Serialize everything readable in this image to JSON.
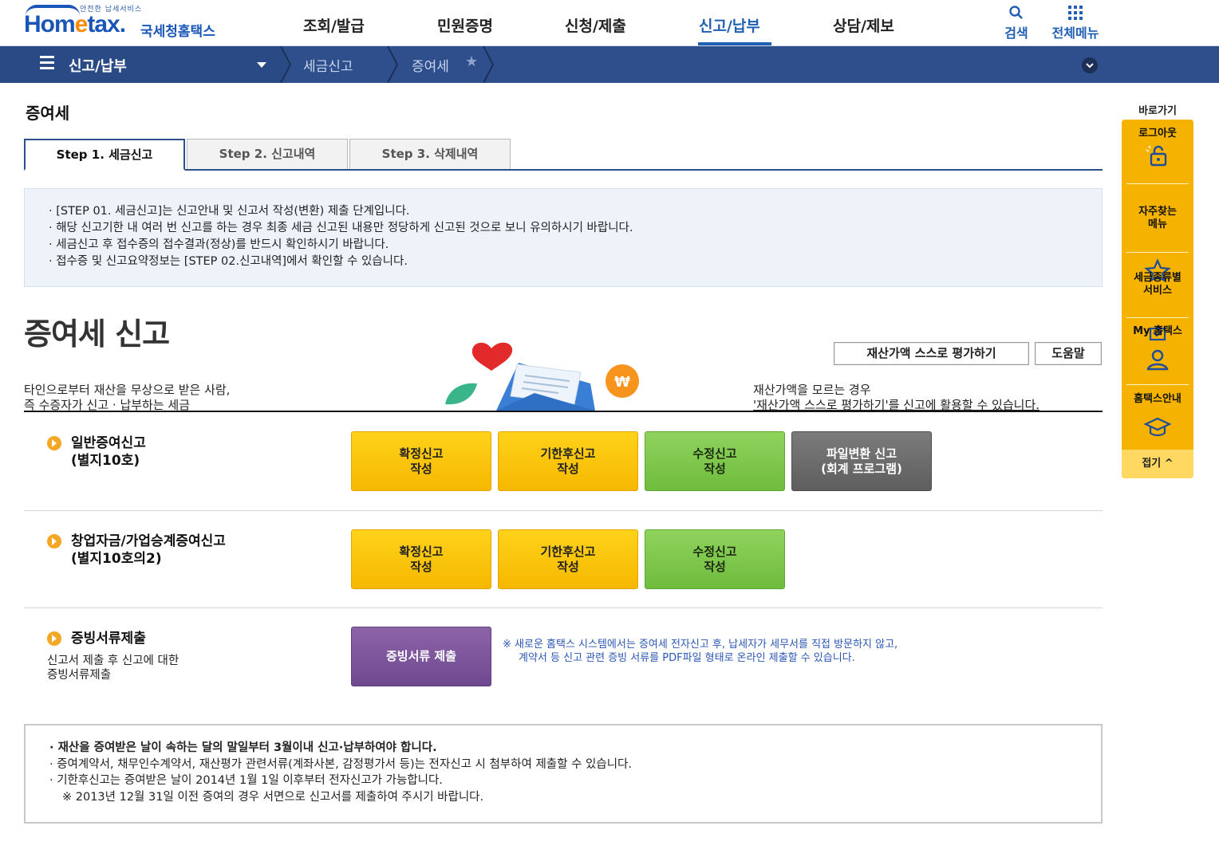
{
  "header": {
    "logo_tagline": "안전한 납세서비스",
    "logo_main_a": "Hom",
    "logo_main_e": "e",
    "logo_main_b": "tax.",
    "logo_sub": "국세청홈택스",
    "menu": [
      "조회/발급",
      "민원증명",
      "신청/제출",
      "신고/납부",
      "상담/제보"
    ],
    "active_menu_index": 3,
    "search_label": "검색",
    "all_menu_label": "전체메뉴"
  },
  "navbar": {
    "section": "신고/납부",
    "crumb1": "세금신고",
    "crumb2": "증여세",
    "star_icon": "star-icon",
    "collapse_icon": "chevron-down-icon"
  },
  "page": {
    "title": "증여세",
    "tabs": [
      "Step 1. 세금신고",
      "Step 2. 신고내역",
      "Step 3. 삭제내역"
    ],
    "active_tab": 0,
    "info_lines": [
      "[STEP 01. 세금신고]는 신고안내 및 신고서 작성(변환) 제출 단계입니다.",
      "해당 신고기한 내 여러 번 신고를 하는 경우 최종 세금 신고된 내용만 정당하게 신고된 것으로 보니 유의하시기 바랍니다.",
      "세금신고 후 접수증의 접수결과(정상)를 반드시 확인하시기 바랍니다.",
      "접수증 및 신고요약정보는 [STEP 02.신고내역]에서 확인할 수 있습니다."
    ],
    "big_title": "증여세 신고",
    "intro_left_1": "타인으로부터 재산을 무상으로 받은 사람,",
    "intro_left_2": "즉 수증자가 신고 · 납부하는 세금",
    "intro_right_1": "재산가액을 모르는 경우",
    "intro_right_2": "'재산가액 스스로 평가하기'를 신고에 활용할 수 있습니다.",
    "self_eval_button": "재산가액 스스로 평가하기",
    "help_button": "도움말"
  },
  "sections": {
    "general": {
      "label_1": "일반증여신고",
      "label_2": "(별지10호)",
      "btn_regular": "확정신고\n작성",
      "btn_late": "기한후신고\n작성",
      "btn_amend": "수정신고\n작성",
      "btn_file": "파일변환 신고\n(회계 프로그램)"
    },
    "startup": {
      "label_1": "창업자금/가업승계증여신고",
      "label_2": "(별지10호의2)",
      "btn_regular": "확정신고\n작성",
      "btn_late": "기한후신고\n작성",
      "btn_amend": "수정신고\n작성"
    },
    "docs": {
      "label": "증빙서류제출",
      "desc_1": "신고서 제출 후 신고에 대한",
      "desc_2": "증빙서류제출",
      "btn_submit": "증빙서류 제출",
      "notice_1": "※ 새로운 홈택스 시스템에서는 증여세 전자신고 후, 납세자가 세무서를 직접 방문하지 않고,",
      "notice_2": "계약서 등 신고 관련 증빙 서류를 PDF파일 형태로 온라인 제출할 수 있습니다."
    }
  },
  "bottom_notes": {
    "line1": "재산을 증여받은 날이 속하는 달의 말일부터 3월이내 신고·납부하여야 합니다.",
    "line2": "증여계약서, 채무인수계약서, 재산평가 관련서류(계좌사본, 감정평가서 등)는 전자신고 시 첨부하여 제출할 수 있습니다.",
    "line3": "기한후신고는 증여받은 날이 2014년 1월 1일 이후부터 전자신고가 가능합니다.",
    "line4": "※ 2013년 12월 31일 이전 증여의 경우 서면으로 신고서를 제출하여 주시기 바랍니다."
  },
  "quick_menu": {
    "title": "바로가기",
    "items": [
      {
        "label": "로그아웃",
        "icon": "unlock-icon"
      },
      {
        "label": "자주찾는\n메뉴",
        "icon": "star-icon"
      },
      {
        "label": "세금종류별\n서비스",
        "icon": "envelope-check-icon"
      },
      {
        "label": "My 홈택스",
        "icon": "user-icon"
      },
      {
        "label": "홈택스안내",
        "icon": "graduation-cap-icon"
      }
    ],
    "fold_label": "접기 ^"
  },
  "colors": {
    "brand_blue": "#1f5fb4",
    "navbar": "#2e4f8c",
    "button_yellow": "#f6b800",
    "button_green": "#6fbc3e",
    "button_gray": "#5e5e5e",
    "button_purple": "#6f4990",
    "quick_menu": "#f5b300"
  }
}
